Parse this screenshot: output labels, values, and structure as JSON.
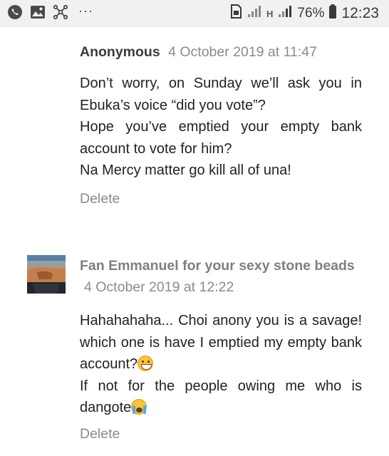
{
  "status_bar": {
    "battery_percent": "76%",
    "time": "12:23",
    "more_label": "···",
    "network_label": "H",
    "icons": [
      "whatsapp-icon",
      "gallery-icon",
      "network-icon",
      "sim-icon",
      "signal-icon",
      "battery-icon"
    ]
  },
  "comments": [
    {
      "author": "Anonymous",
      "timestamp": "4 October 2019 at 11:47",
      "body_lines": [
        "Don’t worry, on Sunday we’ll ask you in Ebuka’s voice “did you vote”?",
        "Hope you’ve emptied your empty bank account to vote for him?",
        "Na Mercy matter go kill all of una!"
      ],
      "delete_label": "Delete"
    },
    {
      "author": "Fan Emmanuel for your sexy stone beads",
      "timestamp": "4 October 2019 at 12:22",
      "body_lines": [
        "Hahahahaha... Choi anony you is a savage! which one is have I emptied my empty bank account?",
        "If not for the people owing me who is dangote"
      ],
      "delete_label": "Delete"
    }
  ]
}
